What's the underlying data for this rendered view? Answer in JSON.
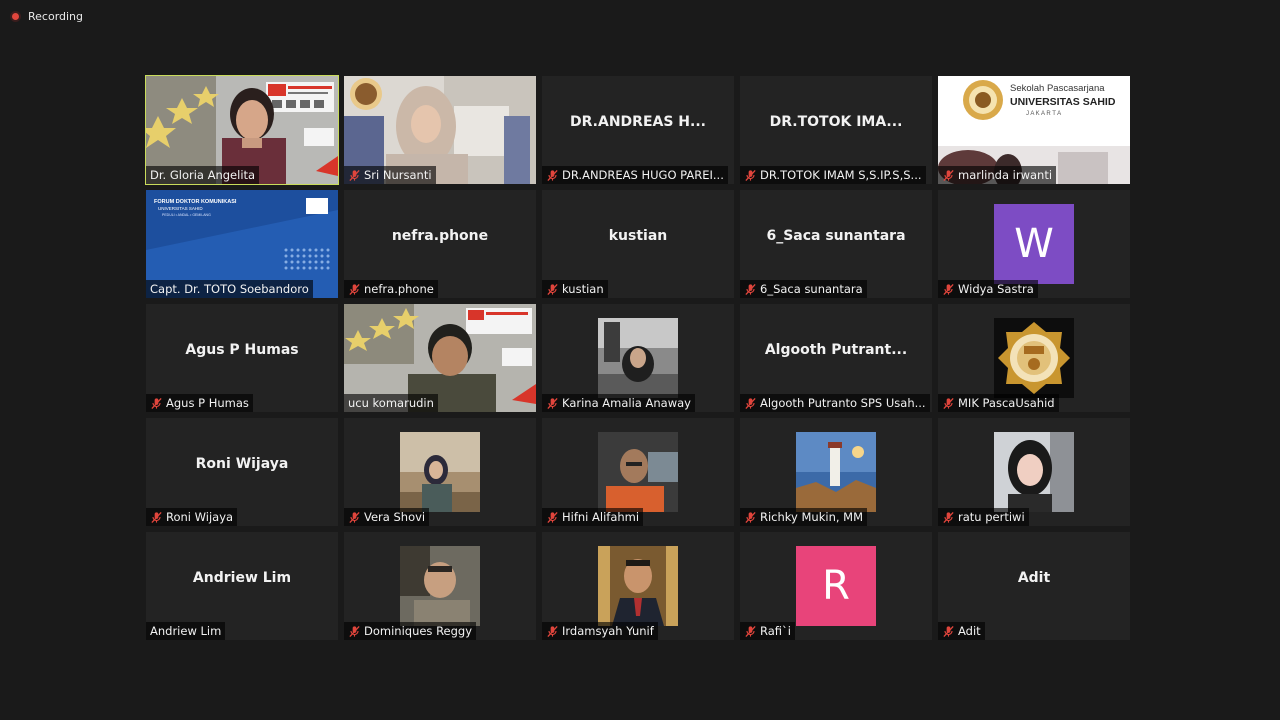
{
  "recording": {
    "label": "Recording"
  },
  "colors": {
    "background": "#1a1a1a",
    "tile": "#232323",
    "active_speaker_border": "#c9dc5b",
    "muted_icon": "#e0453c",
    "avatar_w": "#7d4cc4",
    "avatar_r": "#e8447a"
  },
  "participants": [
    {
      "label": "Dr. Gloria Angelita",
      "muted": false,
      "active": true,
      "video": "presentation-speaker"
    },
    {
      "label": "Sri Nursanti",
      "muted": true,
      "video": "webcam"
    },
    {
      "center": "DR.ANDREAS  H...",
      "label": "DR.ANDREAS HUGO PAREI...",
      "muted": true
    },
    {
      "center": "DR.TOTOK  IMA...",
      "label": "DR.TOTOK IMAM S,S.IP.S,S...",
      "muted": true
    },
    {
      "label": "marlinda irwanti",
      "muted": true,
      "video": "logo-banner",
      "banner_text": {
        "line1": "Sekolah Pascasarjana",
        "line2": "UNIVERSITAS SAHID",
        "line3": "J A K A R T A"
      }
    },
    {
      "label": "Capt. Dr. TOTO Soebandoro",
      "muted": false,
      "video": "blue-slide",
      "slide_text": {
        "line1": "FORUM DOKTOR KOMUNIKASI",
        "line2": "UNIVERSITAS SAHID",
        "line3": "PEDULI • ANDAL • GEMILANG"
      }
    },
    {
      "center": "nefra.phone",
      "label": "nefra.phone",
      "muted": true
    },
    {
      "center": "kustian",
      "label": "kustian",
      "muted": true
    },
    {
      "center": "6_Saca sunantara",
      "label": "6_Saca sunantara",
      "muted": true
    },
    {
      "avatar": "W",
      "label": "Widya Sastra",
      "muted": true
    },
    {
      "center": "Agus P Humas",
      "label": "Agus P Humas",
      "muted": true
    },
    {
      "label": "ucu komarudin",
      "muted": false,
      "video": "presentation-speaker"
    },
    {
      "label": "Karina Amalia Anaway",
      "muted": true,
      "video": "photo"
    },
    {
      "center": "Algooth  Putrant...",
      "label": "Algooth Putranto SPS Usah...",
      "muted": true
    },
    {
      "label": "MIK PascaUsahid",
      "muted": true,
      "video": "emblem"
    },
    {
      "center": "Roni Wijaya",
      "label": "Roni Wijaya",
      "muted": true
    },
    {
      "label": "Vera Shovi",
      "muted": true,
      "video": "photo"
    },
    {
      "label": "Hifni Alifahmi",
      "muted": true,
      "video": "photo"
    },
    {
      "label": "Richky Mukin, MM",
      "muted": true,
      "video": "lighthouse"
    },
    {
      "label": "ratu pertiwi",
      "muted": true,
      "video": "photo"
    },
    {
      "center": "Andriew Lim",
      "label": "Andriew Lim",
      "muted": false
    },
    {
      "label": "Dominiques Reggy",
      "muted": true,
      "video": "photo"
    },
    {
      "label": "Irdamsyah Yunif",
      "muted": true,
      "video": "photo"
    },
    {
      "avatar": "R",
      "label": "Rafi`i",
      "muted": true
    },
    {
      "center": "Adit",
      "label": "Adit",
      "muted": true
    }
  ]
}
